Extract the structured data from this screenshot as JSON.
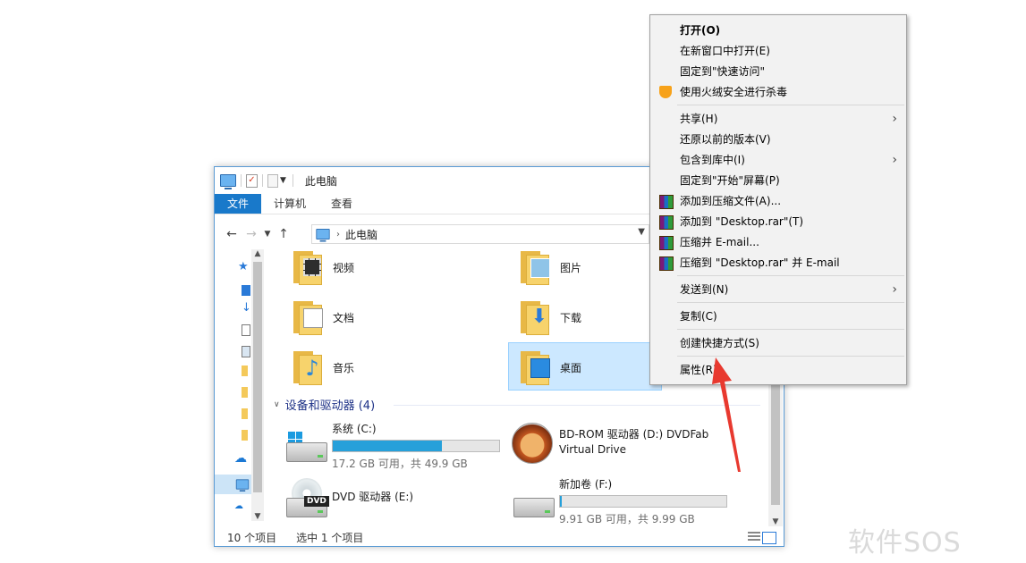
{
  "window": {
    "title": "此电脑",
    "ribbon_tabs": [
      "文件",
      "计算机",
      "查看"
    ],
    "address": "此电脑"
  },
  "folders": [
    {
      "name": "视频",
      "icon": "video-folder-icon"
    },
    {
      "name": "图片",
      "icon": "pictures-folder-icon"
    },
    {
      "name": "文档",
      "icon": "documents-folder-icon"
    },
    {
      "name": "下载",
      "icon": "downloads-folder-icon"
    },
    {
      "name": "音乐",
      "icon": "music-folder-icon"
    },
    {
      "name": "桌面",
      "icon": "desktop-folder-icon",
      "selected": true
    }
  ],
  "devices_group": {
    "title": "设备和驱动器 (4)",
    "drives": [
      {
        "name": "系统 (C:)",
        "info": "17.2 GB 可用，共 49.9 GB",
        "used_fraction": 0.655
      },
      {
        "name": "BD-ROM 驱动器 (D:) DVDFab",
        "name2": "Virtual Drive"
      },
      {
        "name": "DVD 驱动器 (E:)",
        "tag": "DVD"
      },
      {
        "name": "新加卷 (F:)",
        "info": "9.91 GB 可用，共 9.99 GB",
        "used_fraction": 0.008
      }
    ]
  },
  "status": {
    "count": "10 个项目",
    "selection": "选中 1 个项目"
  },
  "context_menu": {
    "items": [
      {
        "label": "打开(O)",
        "bold": true
      },
      {
        "label": "在新窗口中打开(E)"
      },
      {
        "label": "固定到\"快速访问\""
      },
      {
        "label": "使用火绒安全进行杀毒",
        "icon": "huorong-shield-icon"
      },
      {
        "label": "共享(H)",
        "submenu": true
      },
      {
        "label": "还原以前的版本(V)"
      },
      {
        "label": "包含到库中(I)",
        "submenu": true
      },
      {
        "label": "固定到\"开始\"屏幕(P)"
      },
      {
        "label": "添加到压缩文件(A)...",
        "icon": "winrar-icon"
      },
      {
        "label": "添加到 \"Desktop.rar\"(T)",
        "icon": "winrar-icon"
      },
      {
        "label": "压缩并 E-mail...",
        "icon": "winrar-icon"
      },
      {
        "label": "压缩到 \"Desktop.rar\" 并 E-mail",
        "icon": "winrar-icon"
      },
      {
        "label": "发送到(N)",
        "submenu": true
      },
      {
        "label": "复制(C)"
      },
      {
        "label": "创建快捷方式(S)"
      },
      {
        "label": "属性(R)"
      }
    ]
  },
  "watermark": "软件SOS",
  "colors": {
    "accent": "#1979ca",
    "selection": "#cce8ff",
    "annotation_arrow": "#e8392f"
  }
}
